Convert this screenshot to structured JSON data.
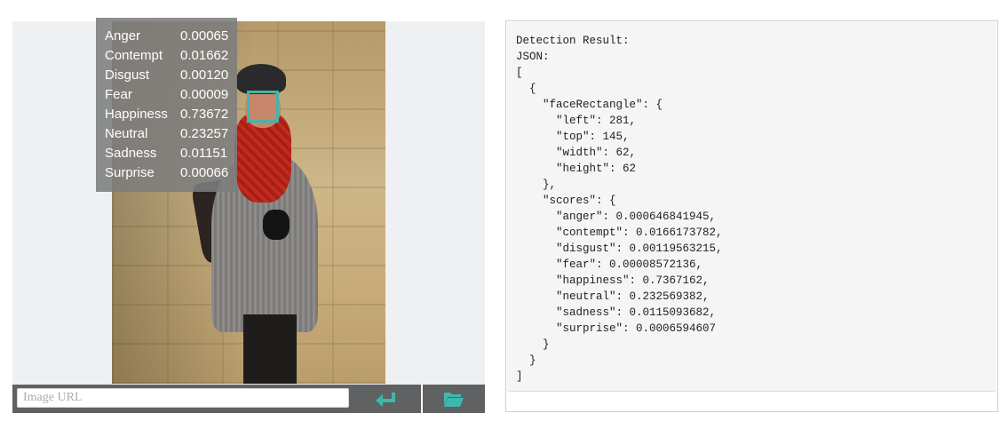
{
  "scores_overlay": {
    "rows": [
      {
        "label": "Anger",
        "value": "0.00065"
      },
      {
        "label": "Contempt",
        "value": "0.01662"
      },
      {
        "label": "Disgust",
        "value": "0.00120"
      },
      {
        "label": "Fear",
        "value": "0.00009"
      },
      {
        "label": "Happiness",
        "value": "0.73672"
      },
      {
        "label": "Neutral",
        "value": "0.23257"
      },
      {
        "label": "Sadness",
        "value": "0.01151"
      },
      {
        "label": "Surprise",
        "value": "0.00066"
      }
    ]
  },
  "url_bar": {
    "placeholder": "Image URL",
    "submit_icon": "enter-arrow-icon",
    "folder_icon": "open-folder-icon"
  },
  "colors": {
    "accent": "#3fb7ac",
    "face_box": "#3fb7ac",
    "url_bar_bg": "#5f6163",
    "overlay_bg": "#7d7d7d"
  },
  "result": {
    "text": "Detection Result:\nJSON:\n[\n  {\n    \"faceRectangle\": {\n      \"left\": 281,\n      \"top\": 145,\n      \"width\": 62,\n      \"height\": 62\n    },\n    \"scores\": {\n      \"anger\": 0.000646841945,\n      \"contempt\": 0.0166173782,\n      \"disgust\": 0.00119563215,\n      \"fear\": 0.00008572136,\n      \"happiness\": 0.7367162,\n      \"neutral\": 0.232569382,\n      \"sadness\": 0.0115093682,\n      \"surprise\": 0.0006594607\n    }\n  }\n]"
  }
}
